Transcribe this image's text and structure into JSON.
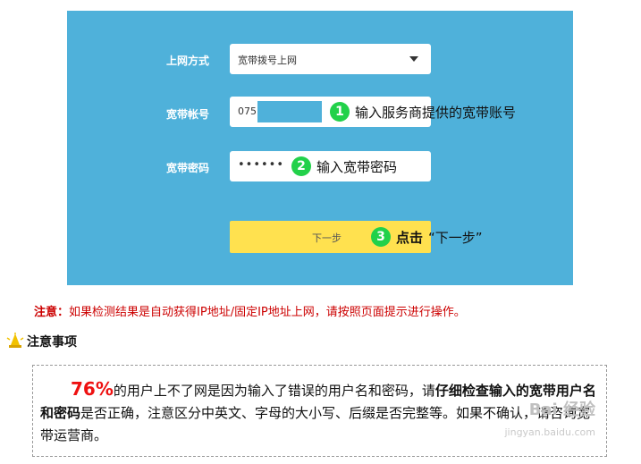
{
  "form": {
    "mode_label": "上网方式",
    "mode_value": "宽带拨号上网",
    "account_label": "宽带帐号",
    "account_value": "075",
    "password_label": "宽带密码",
    "password_value": "••••••",
    "next_button": "下一步"
  },
  "annotations": [
    {
      "num": "1",
      "text": "输入服务商提供的宽带账号"
    },
    {
      "num": "2",
      "text": "输入宽带密码"
    },
    {
      "num": "3",
      "text": "点击",
      "suffix": "“下一步”"
    }
  ],
  "note": {
    "head": "注意：",
    "text": "如果检测结果是自动获得IP地址/固定IP地址上网，请按照页面提示进行操作。"
  },
  "tips": {
    "title": "注意事项",
    "pct": "76%",
    "text1": "的用户上不了网是因为输入了错误的用户名和密码，请",
    "bold1": "仔细检查输入的宽带用户名和密码",
    "text2": "是否正确，注意区分中英文、字母的大小写、后缀是否完整等。如果不确认，请咨询宽带运营商。"
  },
  "watermark": {
    "brand": "Bai 经验",
    "url": "jingyan.baidu.com"
  },
  "colors": {
    "panel": "#4fb1da",
    "button": "#ffe14f",
    "badge": "#22d14a",
    "note": "#cc0000",
    "percent": "#ee1111"
  }
}
